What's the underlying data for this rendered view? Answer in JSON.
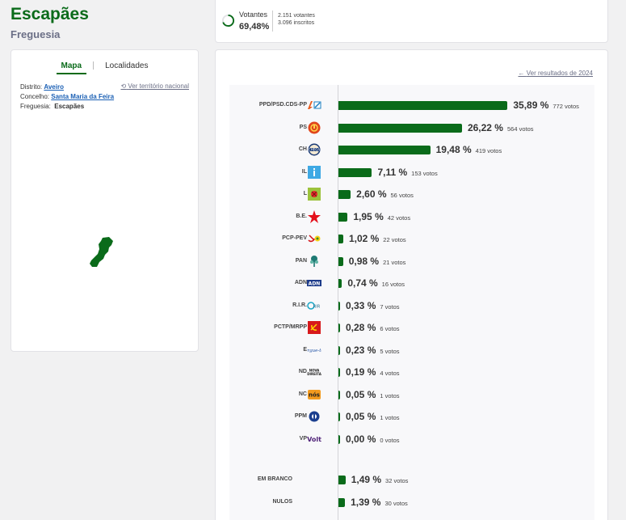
{
  "header": {
    "title": "Escapães",
    "subtitle": "Freguesia"
  },
  "map_panel": {
    "tabs": [
      {
        "label": "Mapa",
        "active": true
      },
      {
        "label": "Localidades",
        "active": false
      }
    ],
    "distrito_label": "Distrito:",
    "distrito_value": "Aveiro",
    "concelho_label": "Concelho:",
    "concelho_value": "Santa Maria da Feira",
    "freguesia_label": "Freguesia:",
    "freguesia_value": "Escapães",
    "national_link": "Ver território nacional"
  },
  "turnout": {
    "label": "Votantes",
    "percent": "69,48%",
    "percent_value": 69.48,
    "voters": "2.151 votantes",
    "registered": "3.096 inscritos"
  },
  "results": {
    "back_link": "Ver resultados de 2024",
    "bar_color": "#0a6b1a",
    "parties": [
      {
        "name": "PPD/PSD.CDS-PP",
        "icon": "ad-coalition-logo-icon",
        "percent": "35,89 %",
        "value": 35.89,
        "votes": "772 votos"
      },
      {
        "name": "PS",
        "icon": "ps-logo-icon",
        "percent": "26,22 %",
        "value": 26.22,
        "votes": "564 votos"
      },
      {
        "name": "CH",
        "icon": "chega-logo-icon",
        "percent": "19,48 %",
        "value": 19.48,
        "votes": "419 votos"
      },
      {
        "name": "IL",
        "icon": "il-logo-icon",
        "percent": "7,11 %",
        "value": 7.11,
        "votes": "153 votos"
      },
      {
        "name": "L",
        "icon": "livre-logo-icon",
        "percent": "2,60 %",
        "value": 2.6,
        "votes": "56 votos"
      },
      {
        "name": "B.E.",
        "icon": "be-star-logo-icon",
        "percent": "1,95 %",
        "value": 1.95,
        "votes": "42 votos"
      },
      {
        "name": "PCP-PEV",
        "icon": "cdu-logo-icon",
        "percent": "1,02 %",
        "value": 1.02,
        "votes": "22 votos"
      },
      {
        "name": "PAN",
        "icon": "pan-logo-icon",
        "percent": "0,98 %",
        "value": 0.98,
        "votes": "21 votos"
      },
      {
        "name": "ADN",
        "icon": "adn-logo-icon",
        "percent": "0,74 %",
        "value": 0.74,
        "votes": "16 votos"
      },
      {
        "name": "R.I.R.",
        "icon": "rir-logo-icon",
        "percent": "0,33 %",
        "value": 0.33,
        "votes": "7 votos"
      },
      {
        "name": "PCTP/MRPP",
        "icon": "mrpp-logo-icon",
        "percent": "0,28 %",
        "value": 0.28,
        "votes": "6 votos"
      },
      {
        "name": "E",
        "icon": "ergue-te-logo-icon",
        "percent": "0,23 %",
        "value": 0.23,
        "votes": "5 votos"
      },
      {
        "name": "ND",
        "icon": "nova-direita-logo-icon",
        "percent": "0,19 %",
        "value": 0.19,
        "votes": "4 votos"
      },
      {
        "name": "NC",
        "icon": "nos-cidadaos-logo-icon",
        "percent": "0,05 %",
        "value": 0.05,
        "votes": "1 votos"
      },
      {
        "name": "PPM",
        "icon": "ppm-logo-icon",
        "percent": "0,05 %",
        "value": 0.05,
        "votes": "1 votos"
      },
      {
        "name": "VP",
        "icon": "volt-logo-icon",
        "percent": "0,00 %",
        "value": 0.0,
        "votes": "0 votos"
      }
    ],
    "others": [
      {
        "name": "EM BRANCO",
        "percent": "1,49 %",
        "value": 1.49,
        "votes": "32 votos"
      },
      {
        "name": "NULOS",
        "percent": "1,39 %",
        "value": 1.39,
        "votes": "30 votos"
      }
    ]
  }
}
